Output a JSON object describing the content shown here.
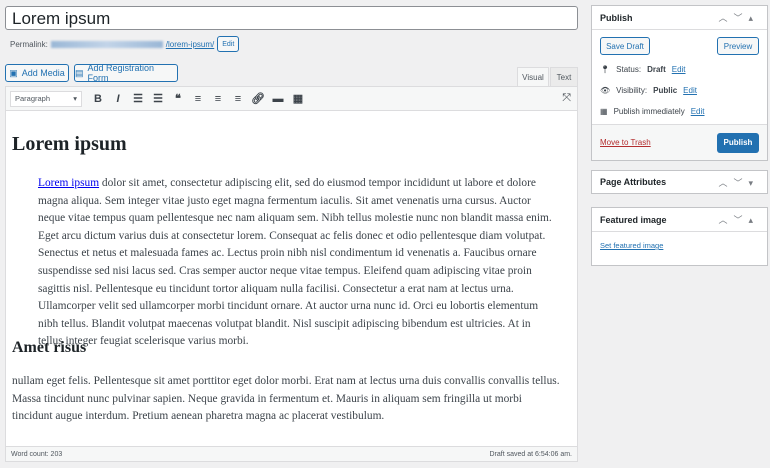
{
  "title": "Lorem ipsum",
  "permalink": {
    "label": "Permalink:",
    "slug": "/lorem-ipsum/",
    "edit": "Edit"
  },
  "buttons": {
    "add_media": "Add Media",
    "add_form": "Add Registration Form"
  },
  "tabs": {
    "visual": "Visual",
    "text": "Text"
  },
  "toolbar": {
    "format": "Paragraph"
  },
  "content": {
    "h1": "Lorem ipsum",
    "p1_link": "Lorem ipsum",
    "p1": " dolor sit amet, consectetur adipiscing elit, sed do eiusmod tempor incididunt ut labore et dolore magna aliqua. Sem integer vitae justo eget magna fermentum iaculis. Sit amet venenatis urna cursus. Auctor neque vitae tempus quam pellentesque nec nam aliquam sem. Nibh tellus molestie nunc non blandit massa enim. Eget arcu dictum varius duis at consectetur lorem. Consequat ac felis donec et odio pellentesque diam volutpat. Senectus et netus et malesuada fames ac. Lectus proin nibh nisl condimentum id venenatis a. Faucibus ornare suspendisse sed nisi lacus sed. Cras semper auctor neque vitae tempus. Eleifend quam adipiscing vitae proin sagittis nisl. Pellentesque eu tincidunt tortor aliquam nulla facilisi. Consectetur a erat nam at lectus urna. Ullamcorper velit sed ullamcorper morbi tincidunt ornare. At auctor urna nunc id. Orci eu lobortis elementum nibh tellus. Blandit volutpat maecenas volutpat blandit. Nisl suscipit adipiscing bibendum est ultricies. At in tellus integer feugiat scelerisque varius morbi.",
    "h2": "Amet risus",
    "p2": "nullam eget felis. Pellentesque sit amet porttitor eget dolor morbi. Erat nam at lectus urna duis convallis convallis tellus. Massa tincidunt nunc pulvinar sapien. Neque gravida in fermentum et. Mauris in aliquam sem fringilla ut morbi tincidunt augue interdum. Pretium aenean pharetra magna ac placerat vestibulum."
  },
  "status": {
    "word_count": "Word count: 203",
    "saved": "Draft saved at 6:54:06 am."
  },
  "publish": {
    "title": "Publish",
    "save_draft": "Save Draft",
    "preview": "Preview",
    "status_label": "Status:",
    "status_value": "Draft",
    "visibility_label": "Visibility:",
    "visibility_value": "Public",
    "schedule": "Publish immediately",
    "edit": "Edit",
    "trash": "Move to Trash",
    "publish": "Publish"
  },
  "page_attributes": {
    "title": "Page Attributes"
  },
  "featured": {
    "title": "Featured image",
    "link": "Set featured image"
  }
}
